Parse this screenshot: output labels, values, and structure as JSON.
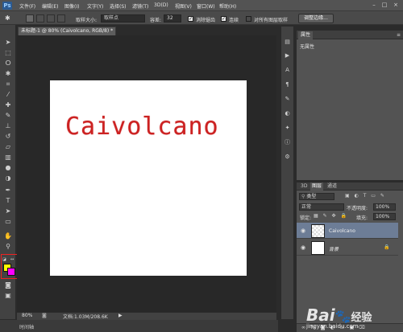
{
  "app": {
    "logo": "Ps",
    "menus": [
      "文件(F)",
      "编辑(E)",
      "图像(I)",
      "文字(Y)",
      "选择(S)",
      "滤镜(T)",
      "3D(D)",
      "视图(V)",
      "窗口(W)",
      "帮助(H)"
    ],
    "window_controls": [
      "–",
      "□",
      "×"
    ]
  },
  "options": {
    "sample_size_label": "取样大小:",
    "sample_size_value": "取样点",
    "tolerance_label": "容差:",
    "tolerance_value": "32",
    "antialias_label": "消除锯齿",
    "contiguous_label": "连续",
    "all_layers_label": "对所有图层取样",
    "refine_edge_button": "调整边缘..."
  },
  "document": {
    "tab_title": "未标题-1 @ 80% (Caivolcano, RGB/8) *",
    "canvas_text": "Caivolcano"
  },
  "status": {
    "zoom": "80%",
    "doc_info": "文档:1.03M/208.6K",
    "timeline_label": "时间轴"
  },
  "properties_panel": {
    "tab": "属性",
    "content": "无属性"
  },
  "layers_panel": {
    "tabs": [
      "3D",
      "图层",
      "通道"
    ],
    "filter_kind": "类型",
    "blend_mode": "正常",
    "opacity_label": "不透明度:",
    "opacity_value": "100%",
    "lock_label": "锁定:",
    "fill_label": "填充:",
    "fill_value": "100%",
    "layers": [
      {
        "name": "Caivolcano",
        "selected": true
      },
      {
        "name": "背景",
        "selected": false,
        "locked": true
      }
    ]
  },
  "watermark": {
    "text": "Bai",
    "suffix": "经验",
    "url": "jingyan.baidu.com"
  },
  "colors": {
    "foreground": "#ffff00",
    "background": "#ff00ff",
    "canvas_text_color": "#cc2222",
    "highlight_box": "#ee2222"
  }
}
